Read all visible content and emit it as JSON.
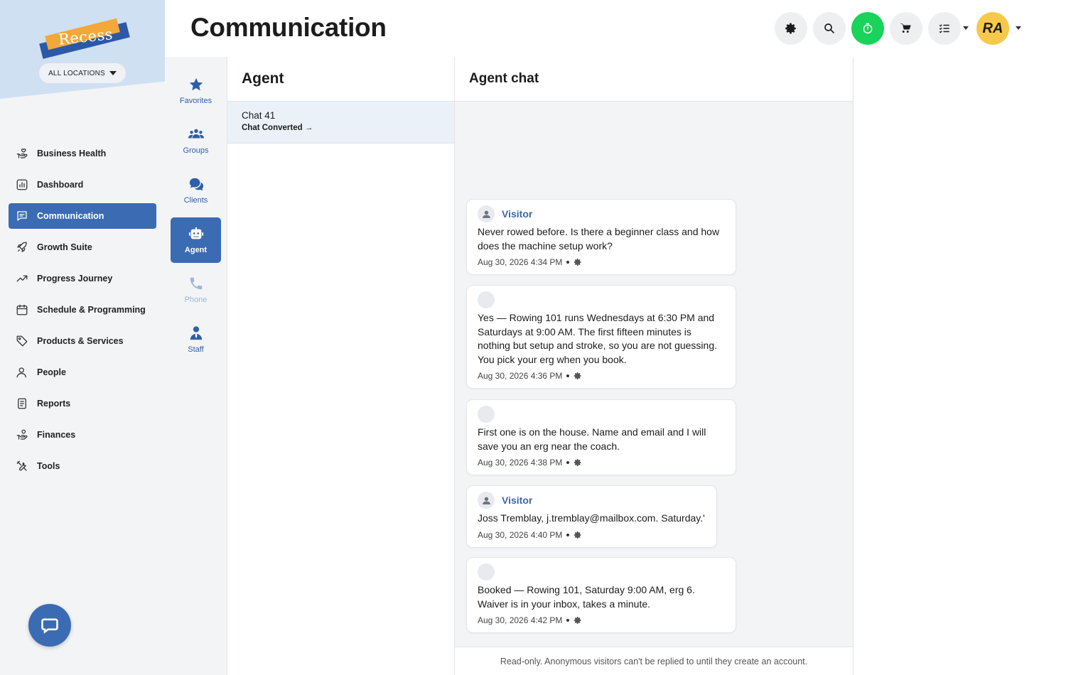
{
  "brand": {
    "logo_text": "Recess",
    "location_button": "ALL LOCATIONS"
  },
  "header": {
    "title": "Communication",
    "avatar_initials": "RA"
  },
  "sidebar": {
    "items": [
      {
        "label": "Business Health",
        "icon": "hand-heart-icon"
      },
      {
        "label": "Dashboard",
        "icon": "chart-icon"
      },
      {
        "label": "Communication",
        "icon": "message-icon",
        "active": true
      },
      {
        "label": "Growth Suite",
        "icon": "rocket-icon"
      },
      {
        "label": "Progress Journey",
        "icon": "trend-up-icon"
      },
      {
        "label": "Schedule & Programming",
        "icon": "calendar-icon"
      },
      {
        "label": "Products & Services",
        "icon": "tag-icon"
      },
      {
        "label": "People",
        "icon": "person-icon"
      },
      {
        "label": "Reports",
        "icon": "report-icon"
      },
      {
        "label": "Finances",
        "icon": "hand-coin-icon"
      },
      {
        "label": "Tools",
        "icon": "tools-icon"
      }
    ]
  },
  "subnav": {
    "items": [
      {
        "label": "Favorites",
        "icon": "star-icon"
      },
      {
        "label": "Groups",
        "icon": "groups-icon"
      },
      {
        "label": "Clients",
        "icon": "chat-bubbles-icon"
      },
      {
        "label": "Agent",
        "icon": "robot-icon",
        "active": true
      },
      {
        "label": "Phone",
        "icon": "phone-icon",
        "disabled": true
      },
      {
        "label": "Staff",
        "icon": "staff-icon"
      }
    ]
  },
  "agent_panel": {
    "title": "Agent",
    "chats": [
      {
        "name": "Chat 41",
        "status": "Chat Converted →"
      }
    ]
  },
  "chat": {
    "title": "Agent chat",
    "footer_note": "Read-only. Anonymous visitors can't be replied to until they create an account.",
    "messages": [
      {
        "sender": "Visitor",
        "text": "Never rowed before. Is there a beginner class and how does the machine setup work?",
        "time": "Aug 30, 2026 4:34 PM"
      },
      {
        "sender": "",
        "text": "Yes — Rowing 101 runs Wednesdays at 6:30 PM and Saturdays at 9:00 AM. The first fifteen minutes is nothing but setup and stroke, so you are not guessing. You pick your erg when you book.",
        "time": "Aug 30, 2026 4:36 PM"
      },
      {
        "sender": "",
        "text": "First one is on the house. Name and email and I will save you an erg near the coach.",
        "time": "Aug 30, 2026 4:38 PM"
      },
      {
        "sender": "Visitor",
        "text": "Joss Tremblay, j.tremblay@mailbox.com. Saturday.'",
        "time": "Aug 30, 2026 4:40 PM"
      },
      {
        "sender": "",
        "text": "Booked — Rowing 101, Saturday 9:00 AM, erg 6. Waiver is in your inbox, takes a minute.",
        "time": "Aug 30, 2026 4:42 PM"
      }
    ]
  },
  "colors": {
    "accent": "#3b6bb3",
    "timer": "#19d35a",
    "avatar": "#f7c94a"
  }
}
